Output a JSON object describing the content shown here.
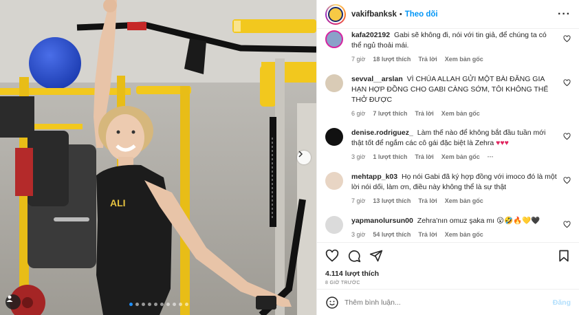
{
  "post": {
    "username": "vakifbanksk",
    "separator": "•",
    "follow_label": "Theo dõi",
    "more_label": "···",
    "image_slides": 10,
    "active_slide": 1
  },
  "comments": [
    {
      "user": "kafa202192",
      "text": "Gabi sẽ không đi, nói với tin giả, để chúng ta có thể ngủ thoải mái.",
      "time": "7 giờ",
      "likes": "18 lượt thích",
      "reply": "Trả lời",
      "translate": "Xem bản gốc",
      "avatar_color": "#8aa1c9"
    },
    {
      "user": "sevval__arslan",
      "text": "VÌ CHÚA ALLAH GỬI MỘT BÀI ĐĂNG GIA HẠN HỢP ĐỒNG CHO GABI CÀNG SỚM, TÔI KHÔNG THỂ THỞ ĐƯỢC",
      "time": "6 giờ",
      "likes": "7 lượt thích",
      "reply": "Trả lời",
      "translate": "Xem bản gốc",
      "avatar_color": "#d9cbb6"
    },
    {
      "user": "denise.rodriguez_",
      "text": "Làm thế nào để không bắt đầu tuần mới thật tốt để ngắm các cô gái đặc biệt là Zehra",
      "emoji": "♥♥♥",
      "time": "3 giờ",
      "likes": "1 lượt thích",
      "reply": "Trả lời",
      "translate": "Xem bản gốc",
      "extra": "···",
      "avatar_color": "#111111"
    },
    {
      "user": "mehtapp_k03",
      "text": "Họ nói Gabi đã ký hợp đồng với imoco đó là một lời nói dối, làm ơn, điều này không thể là sự thật",
      "time": "7 giờ",
      "likes": "13 lượt thích",
      "reply": "Trả lời",
      "translate": "Xem bản gốc",
      "avatar_color": "#e8d5c4"
    },
    {
      "user": "yapmanolursun00",
      "text": "Zehra'nın omuz şaka mı",
      "emoji": "😮🤣🔥💛🖤",
      "time": "3 giờ",
      "likes": "54 lượt thích",
      "reply": "Trả lời",
      "translate": "Xem bản gốc",
      "avatar_color": "#dbdbdb"
    }
  ],
  "actions": {
    "like": "heart-icon",
    "comment": "comment-icon",
    "share": "share-icon",
    "save": "bookmark-icon"
  },
  "likes_count": "4.114 lượt thích",
  "time_ago": "8 GIỜ TRƯỚC",
  "composer": {
    "placeholder": "Thêm bình luận...",
    "post_label": "Đăng"
  },
  "colors": {
    "accent": "#0095f6",
    "muted": "#737373",
    "post_disabled": "#b2dffc",
    "photo_yellow": "#f2c81e"
  }
}
